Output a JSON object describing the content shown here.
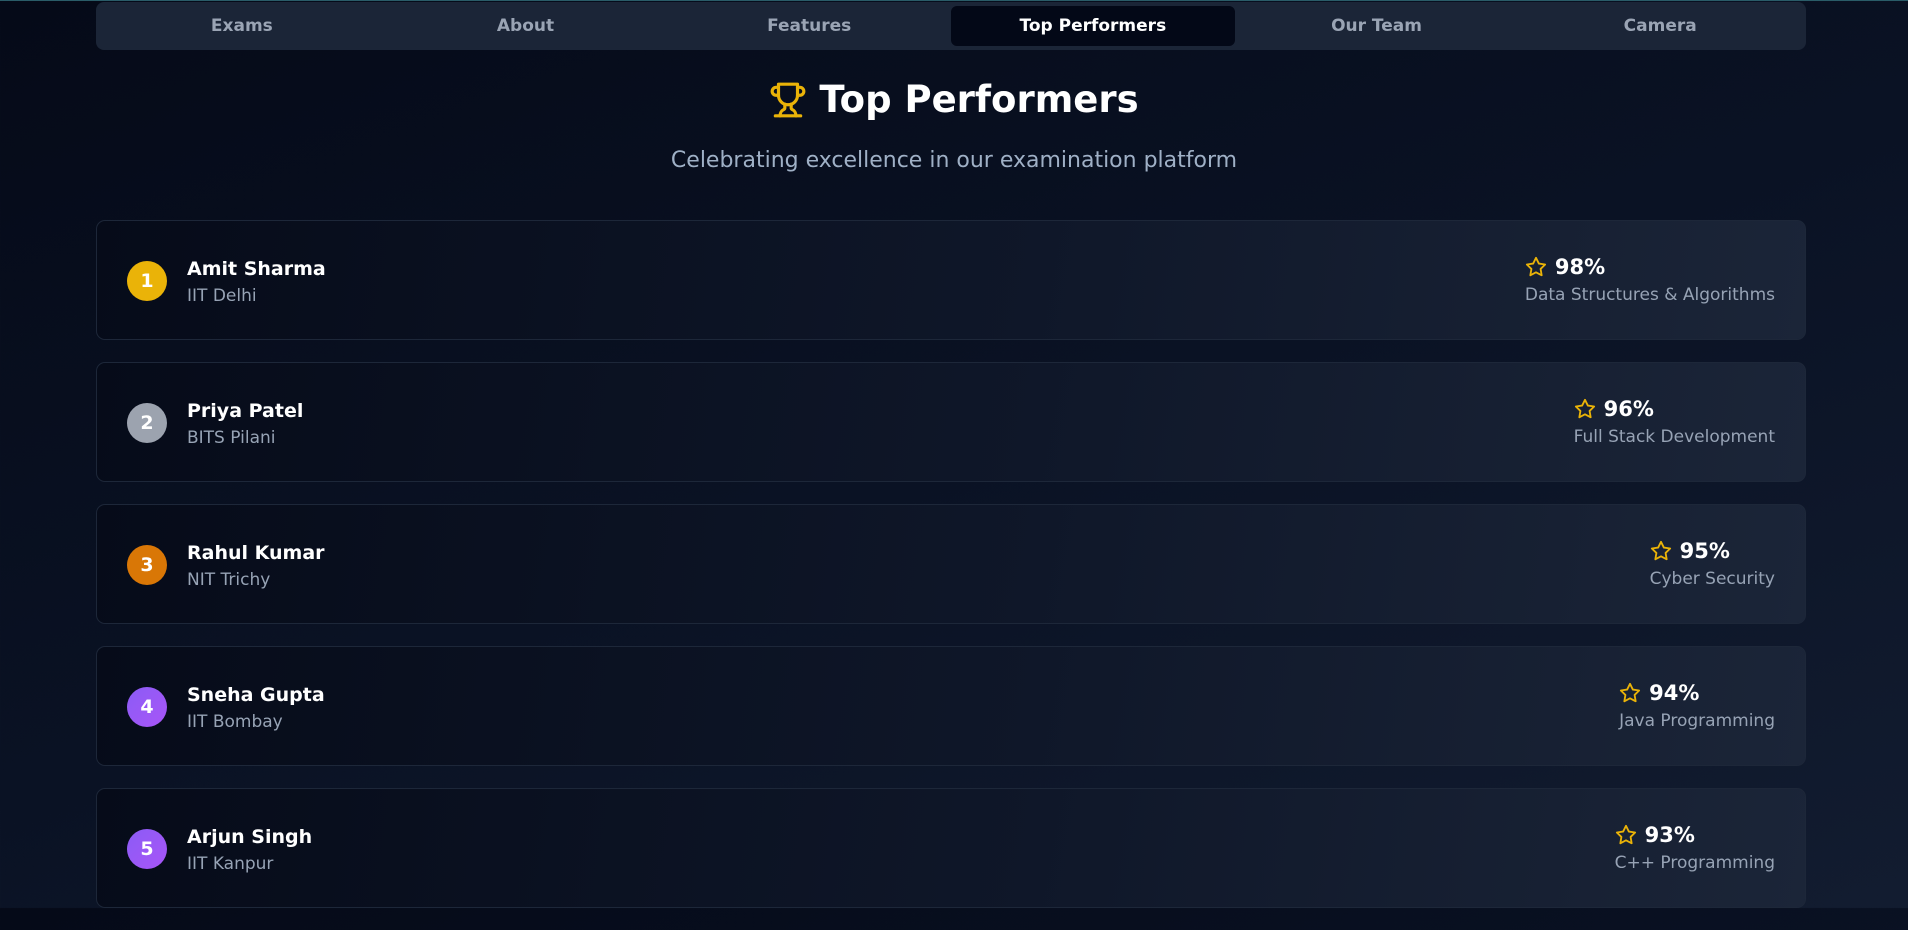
{
  "tabs": [
    {
      "label": "Exams"
    },
    {
      "label": "About"
    },
    {
      "label": "Features"
    },
    {
      "label": "Top Performers",
      "active": true
    },
    {
      "label": "Our Team"
    },
    {
      "label": "Camera"
    }
  ],
  "header": {
    "icon": "trophy-icon",
    "title": "Top Performers",
    "subtitle": "Celebrating excellence in our examination platform"
  },
  "colors": {
    "accent_gold": "#eab308",
    "rank_1": "#eab308",
    "rank_2": "#9ca3af",
    "rank_3": "#d97706",
    "rank_4": "#8b5cf6",
    "rank_5": "#8b5cf6"
  },
  "performers": [
    {
      "rank": "1",
      "name": "Amit Sharma",
      "school": "IIT Delhi",
      "score": "98%",
      "subject": "Data Structures & Algorithms",
      "icon": "star-icon"
    },
    {
      "rank": "2",
      "name": "Priya Patel",
      "school": "BITS Pilani",
      "score": "96%",
      "subject": "Full Stack Development",
      "icon": "star-icon"
    },
    {
      "rank": "3",
      "name": "Rahul Kumar",
      "school": "NIT Trichy",
      "score": "95%",
      "subject": "Cyber Security",
      "icon": "star-icon"
    },
    {
      "rank": "4",
      "name": "Sneha Gupta",
      "school": "IIT Bombay",
      "score": "94%",
      "subject": "Java Programming",
      "icon": "star-icon"
    },
    {
      "rank": "5",
      "name": "Arjun Singh",
      "school": "IIT Kanpur",
      "score": "93%",
      "subject": "C++ Programming",
      "icon": "star-icon"
    }
  ]
}
